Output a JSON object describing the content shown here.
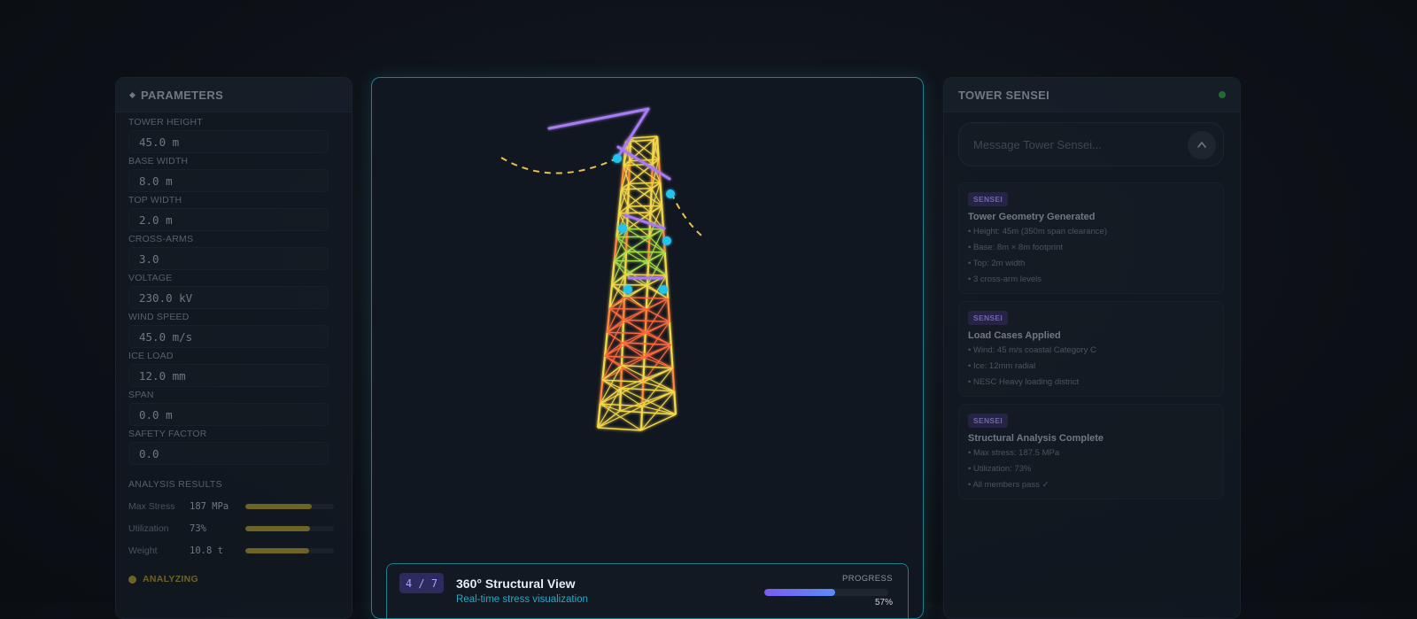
{
  "parameters": {
    "title": "PARAMETERS",
    "fields": [
      {
        "label": "TOWER HEIGHT",
        "value": "45.0 m"
      },
      {
        "label": "BASE WIDTH",
        "value": "8.0 m"
      },
      {
        "label": "TOP WIDTH",
        "value": "2.0 m"
      },
      {
        "label": "CROSS-ARMS",
        "value": "3.0"
      },
      {
        "label": "VOLTAGE",
        "value": "230.0 kV"
      },
      {
        "label": "WIND SPEED",
        "value": "45.0 m/s"
      },
      {
        "label": "ICE LOAD",
        "value": "12.0 mm"
      },
      {
        "label": "SPAN",
        "value": "0.0 m"
      },
      {
        "label": "SAFETY FACTOR",
        "value": "0.0"
      }
    ],
    "results_title": "ANALYSIS RESULTS",
    "results": [
      {
        "label": "Max Stress",
        "value": "187 MPa",
        "fill": 0.75
      },
      {
        "label": "Utilization",
        "value": "73%",
        "fill": 0.73
      },
      {
        "label": "Weight",
        "value": "10.8 t",
        "fill": 0.72
      }
    ],
    "status": "ANALYZING",
    "status_color": "#8a7a2a"
  },
  "viewport": {
    "step": "4 / 7",
    "title": "360° Structural View",
    "subtitle": "Real-time stress visualization",
    "progress_label": "PROGRESS",
    "progress_value": 0.57,
    "progress_text": "57%"
  },
  "sensei": {
    "title": "TOWER SENSEI",
    "input_placeholder": "Message Tower Sensei...",
    "send_icon": "chevron-up-icon",
    "messages": [
      {
        "tag": "SENSEI",
        "title": "Tower Geometry Generated",
        "lines": [
          "• Height: 45m (350m span clearance)",
          "• Base: 8m × 8m footprint",
          "• Top: 2m width",
          "• 3 cross-arm levels"
        ]
      },
      {
        "tag": "SENSEI",
        "title": "Load Cases Applied",
        "lines": [
          "• Wind: 45 m/s coastal Category C",
          "• Ice: 12mm radial",
          "• NESC Heavy loading district"
        ]
      },
      {
        "tag": "SENSEI",
        "title": "Structural Analysis Complete",
        "lines": [
          "• Max stress: 187.5 MPa",
          "• Utilization: 73%",
          "• All members pass ✓"
        ]
      }
    ]
  },
  "colors": {
    "accent": "#1f7f8c",
    "badge_purple": "#2d2a5e",
    "tower_low": "#f5e04a",
    "tower_high": "#ff6a3d",
    "conductor": "#e8c24a",
    "crossarm": "#a77bf0",
    "insulator": "#22c3ee"
  }
}
